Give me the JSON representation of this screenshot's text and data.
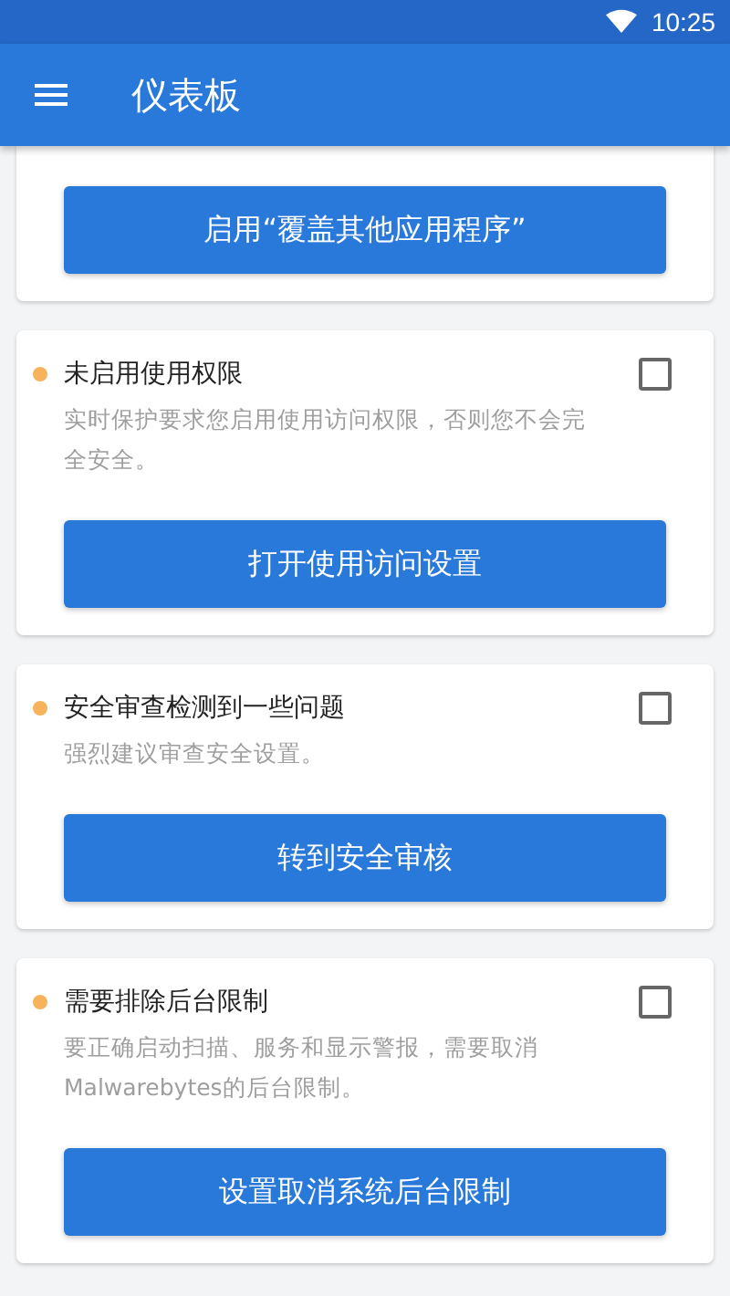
{
  "status_bar": {
    "time": "10:25"
  },
  "app_bar": {
    "title": "仪表板"
  },
  "cards": [
    {
      "button": "启用“覆盖其他应用程序”"
    },
    {
      "title": "未启用使用权限",
      "description": "实时保护要求您启用使用访问权限，否则您不会完全安全。",
      "checked": false,
      "button": "打开使用访问设置"
    },
    {
      "title": "安全审查检测到一些问题",
      "description": "强烈建议审查安全设置。",
      "checked": false,
      "button": "转到安全审核"
    },
    {
      "title": "需要排除后台限制",
      "description": "要正确启动扫描、服务和显示警报，需要取消Malwarebytes的后台限制。",
      "checked": false,
      "button": "设置取消系统后台限制"
    }
  ]
}
